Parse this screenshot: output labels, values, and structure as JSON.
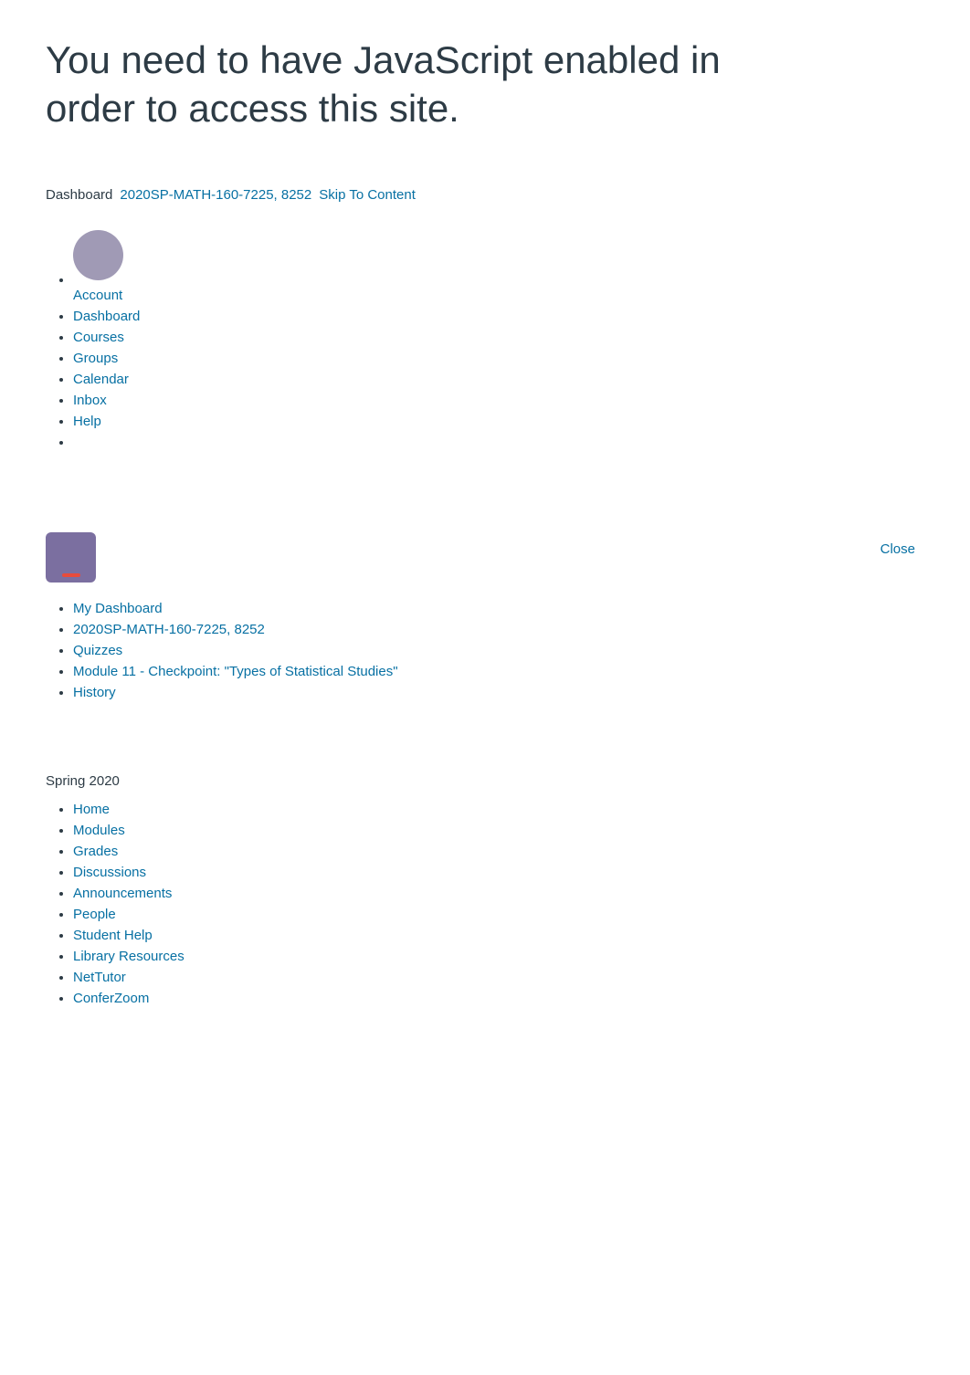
{
  "page": {
    "main_heading": "You need to have JavaScript enabled in order to access this site.",
    "breadcrumb": {
      "dashboard_label": "Dashboard",
      "course_link": "2020SP-MATH-160-7225, 8252",
      "skip_link": "Skip To Content"
    }
  },
  "global_nav": {
    "account_label": "Account",
    "items": [
      {
        "label": "Dashboard",
        "href": "#"
      },
      {
        "label": "Courses",
        "href": "#"
      },
      {
        "label": "Groups",
        "href": "#"
      },
      {
        "label": "Calendar",
        "href": "#"
      },
      {
        "label": "Inbox",
        "href": "#"
      },
      {
        "label": "Help",
        "href": "#"
      }
    ]
  },
  "close_button": "Close",
  "user_nav": {
    "items": [
      {
        "label": "My Dashboard",
        "href": "#"
      },
      {
        "label": "2020SP-MATH-160-7225, 8252",
        "href": "#"
      },
      {
        "label": "Quizzes",
        "href": "#"
      },
      {
        "label": "Module 11 - Checkpoint: \"Types of Statistical Studies\"",
        "href": "#"
      },
      {
        "label": "History",
        "href": "#"
      }
    ]
  },
  "course_section": {
    "semester_label": "Spring 2020",
    "nav_items": [
      {
        "label": "Home",
        "href": "#"
      },
      {
        "label": "Modules",
        "href": "#"
      },
      {
        "label": "Grades",
        "href": "#"
      },
      {
        "label": "Discussions",
        "href": "#"
      },
      {
        "label": "Announcements",
        "href": "#"
      },
      {
        "label": "People",
        "href": "#"
      },
      {
        "label": "Student Help",
        "href": "#"
      },
      {
        "label": "Library Resources",
        "href": "#"
      },
      {
        "label": "NetTutor",
        "href": "#"
      },
      {
        "label": "ConferZoom",
        "href": "#"
      }
    ]
  }
}
